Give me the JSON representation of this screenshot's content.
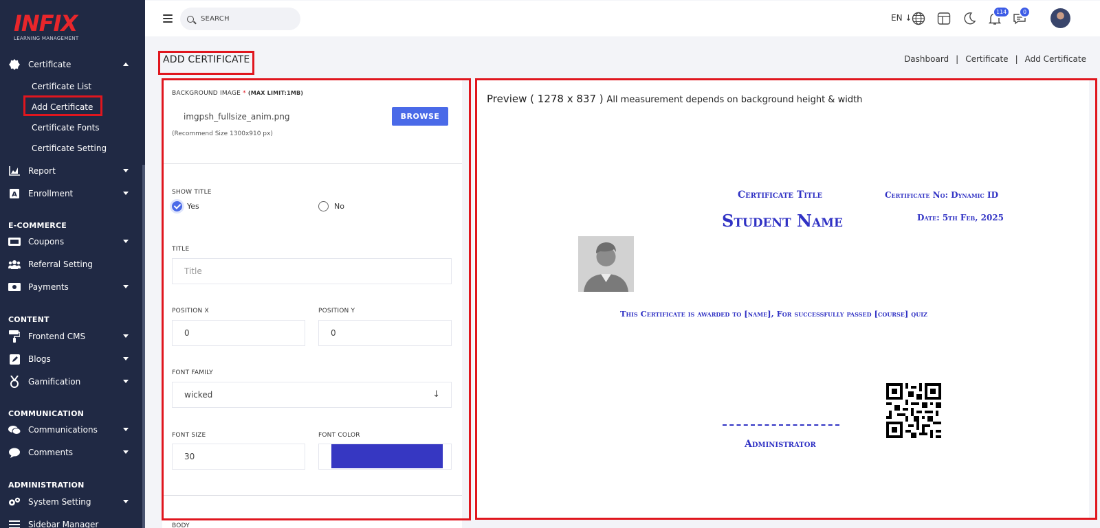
{
  "sidebar": {
    "logo": {
      "brand": "INFIX",
      "tagline": "LEARNING MANAGEMENT"
    },
    "certificate": {
      "label": "Certificate",
      "children": [
        "Certificate List",
        "Add Certificate",
        "Certificate Fonts",
        "Certificate Setting"
      ]
    },
    "items_top": [
      {
        "label": "Report",
        "icon": "chart-icon"
      },
      {
        "label": "Enrollment",
        "icon": "enrollment-icon"
      }
    ],
    "sections": [
      {
        "title": "E-COMMERCE",
        "items": [
          {
            "label": "Coupons",
            "icon": "coupon-icon",
            "has_caret": true
          },
          {
            "label": "Referral Setting",
            "icon": "users-icon",
            "has_caret": false
          },
          {
            "label": "Payments",
            "icon": "payment-icon",
            "has_caret": true
          }
        ]
      },
      {
        "title": "CONTENT",
        "items": [
          {
            "label": "Frontend CMS",
            "icon": "paint-roller-icon",
            "has_caret": true
          },
          {
            "label": "Blogs",
            "icon": "edit-icon",
            "has_caret": true
          },
          {
            "label": "Gamification",
            "icon": "medal-icon",
            "has_caret": true
          }
        ]
      },
      {
        "title": "COMMUNICATION",
        "items": [
          {
            "label": "Communications",
            "icon": "chat-icon",
            "has_caret": true
          },
          {
            "label": "Comments",
            "icon": "comment-icon",
            "has_caret": true
          }
        ]
      },
      {
        "title": "ADMINISTRATION",
        "items": [
          {
            "label": "System Setting",
            "icon": "gears-icon",
            "has_caret": true
          },
          {
            "label": "Sidebar Manager",
            "icon": "bars-icon",
            "has_caret": false
          }
        ]
      }
    ]
  },
  "topbar": {
    "search_placeholder": "SEARCH",
    "language": "EN",
    "notifications_count": "114",
    "messages_count": "0"
  },
  "page": {
    "title": "ADD CERTIFICATE",
    "breadcrumb": [
      "Dashboard",
      "Certificate",
      "Add Certificate"
    ]
  },
  "form": {
    "bg_image_label": "BACKGROUND IMAGE",
    "bg_image_required": "*",
    "bg_image_limit": "(MAX LIMIT:1MB)",
    "bg_image_value": "imgpsh_fullsize_anim.png",
    "browse_label": "BROWSE",
    "recommend_hint": "(Recommend Size 1300x910 px)",
    "show_title_label": "SHOW TITLE",
    "show_title_yes": "Yes",
    "show_title_no": "No",
    "show_title_selected": "Yes",
    "title_label": "TITLE",
    "title_placeholder": "Title",
    "position_x_label": "POSITION X",
    "position_x_value": "0",
    "position_y_label": "POSITION Y",
    "position_y_value": "0",
    "font_family_label": "FONT FAMILY",
    "font_family_value": "wicked",
    "font_size_label": "FONT SIZE",
    "font_size_value": "30",
    "font_color_label": "FONT COLOR",
    "font_color_value": "#3637c2",
    "body_label": "BODY"
  },
  "preview": {
    "heading": "Preview",
    "dimensions": "( 1278 x 837 )",
    "note": "All measurement depends on background height & width",
    "certificate": {
      "title": "Certificate Title",
      "certificate_no": "Certificate No: Dynamic ID",
      "student_name": "Student Name",
      "date": "Date: 5th Feb, 2025",
      "body": "This Certificate is awarded to [name], For successfully passed [course] quiz",
      "signature_label": "Administrator",
      "text_color": "#3032c4"
    }
  },
  "colors": {
    "sidebar_bg": "#202944",
    "accent": "#4a6ae8",
    "highlight_border": "#e0161e"
  }
}
